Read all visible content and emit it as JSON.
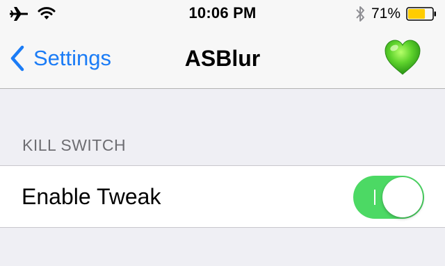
{
  "status_bar": {
    "time": "10:06 PM",
    "battery_percent": "71%",
    "battery_level": 0.71,
    "icons": [
      "airplane-icon",
      "wifi-icon",
      "bluetooth-icon",
      "battery-icon"
    ]
  },
  "nav": {
    "back_label": "Settings",
    "title": "ASBlur",
    "right_icon": "green-heart-icon"
  },
  "section": {
    "header": "KILL SWITCH"
  },
  "cells": [
    {
      "label": "Enable Tweak",
      "switch_on": true
    }
  ],
  "colors": {
    "accent": "#1b7cf6",
    "switch_on": "#4cd964",
    "battery_fill": "#ffcc00",
    "background": "#efeff4"
  }
}
